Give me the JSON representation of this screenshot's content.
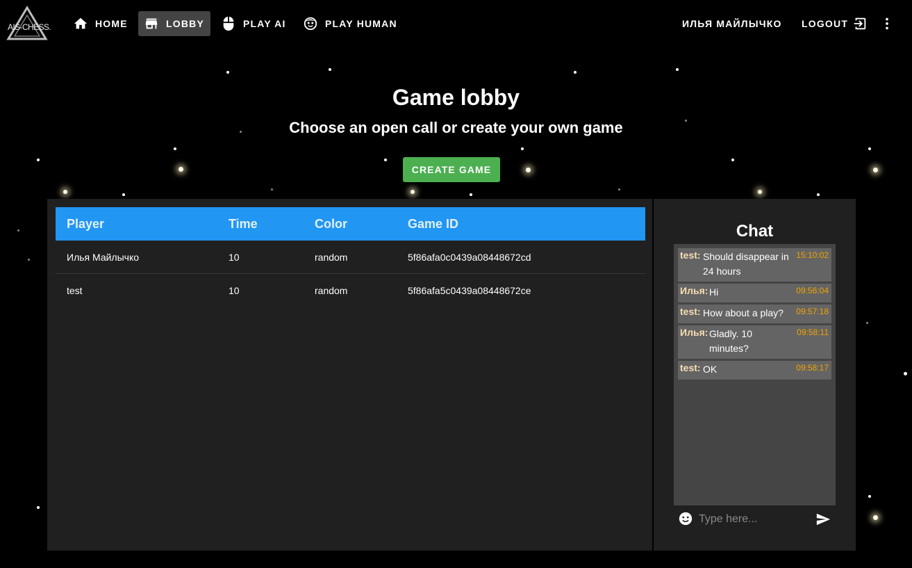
{
  "app": {
    "logo_text": "AIS-CHESS."
  },
  "nav": {
    "items": [
      {
        "label": "HOME",
        "icon": "home-icon"
      },
      {
        "label": "LOBBY",
        "icon": "store-icon",
        "active": true
      },
      {
        "label": "PLAY AI",
        "icon": "mouse-icon"
      },
      {
        "label": "PLAY HUMAN",
        "icon": "face-icon"
      }
    ],
    "user_name": "ИЛЬЯ МАЙЛЫЧКО",
    "logout_label": "LOGOUT",
    "logout_icon": "logout-icon",
    "menu_icon": "more-vert-icon"
  },
  "page": {
    "title": "Game lobby",
    "subtitle": "Choose an open call or create your own game",
    "create_button": "CREATE GAME"
  },
  "games_table": {
    "headers": [
      "Player",
      "Time",
      "Color",
      "Game ID"
    ],
    "rows": [
      [
        "Илья Майлычко",
        "10",
        "random",
        "5f86afa0c0439a08448672cd"
      ],
      [
        "test",
        "10",
        "random",
        "5f86afa5c0439a08448672ce"
      ]
    ]
  },
  "chat": {
    "title": "Chat",
    "messages": [
      {
        "author": "test:",
        "text": "Should disappear in 24 hours",
        "time": "15:10:02"
      },
      {
        "author": "Илья:",
        "text": "Hi",
        "time": "09:56:04"
      },
      {
        "author": "test:",
        "text": "How about a play?",
        "time": "09:57:18"
      },
      {
        "author": "Илья:",
        "text": "Gladly. 10 minutes?",
        "time": "09:58:11"
      },
      {
        "author": "test:",
        "text": "OK",
        "time": "09:58:17"
      }
    ],
    "input_placeholder": "Type here...",
    "emoji_icon": "emoji-icon",
    "send_icon": "send-icon"
  },
  "colors": {
    "background": "#000000",
    "panel": "#202020",
    "table_header": "#2196f3",
    "create_button": "#4caf50",
    "active_nav": "#444444",
    "chat_time": "#f2a400",
    "chat_author": "#f5ddb2"
  }
}
